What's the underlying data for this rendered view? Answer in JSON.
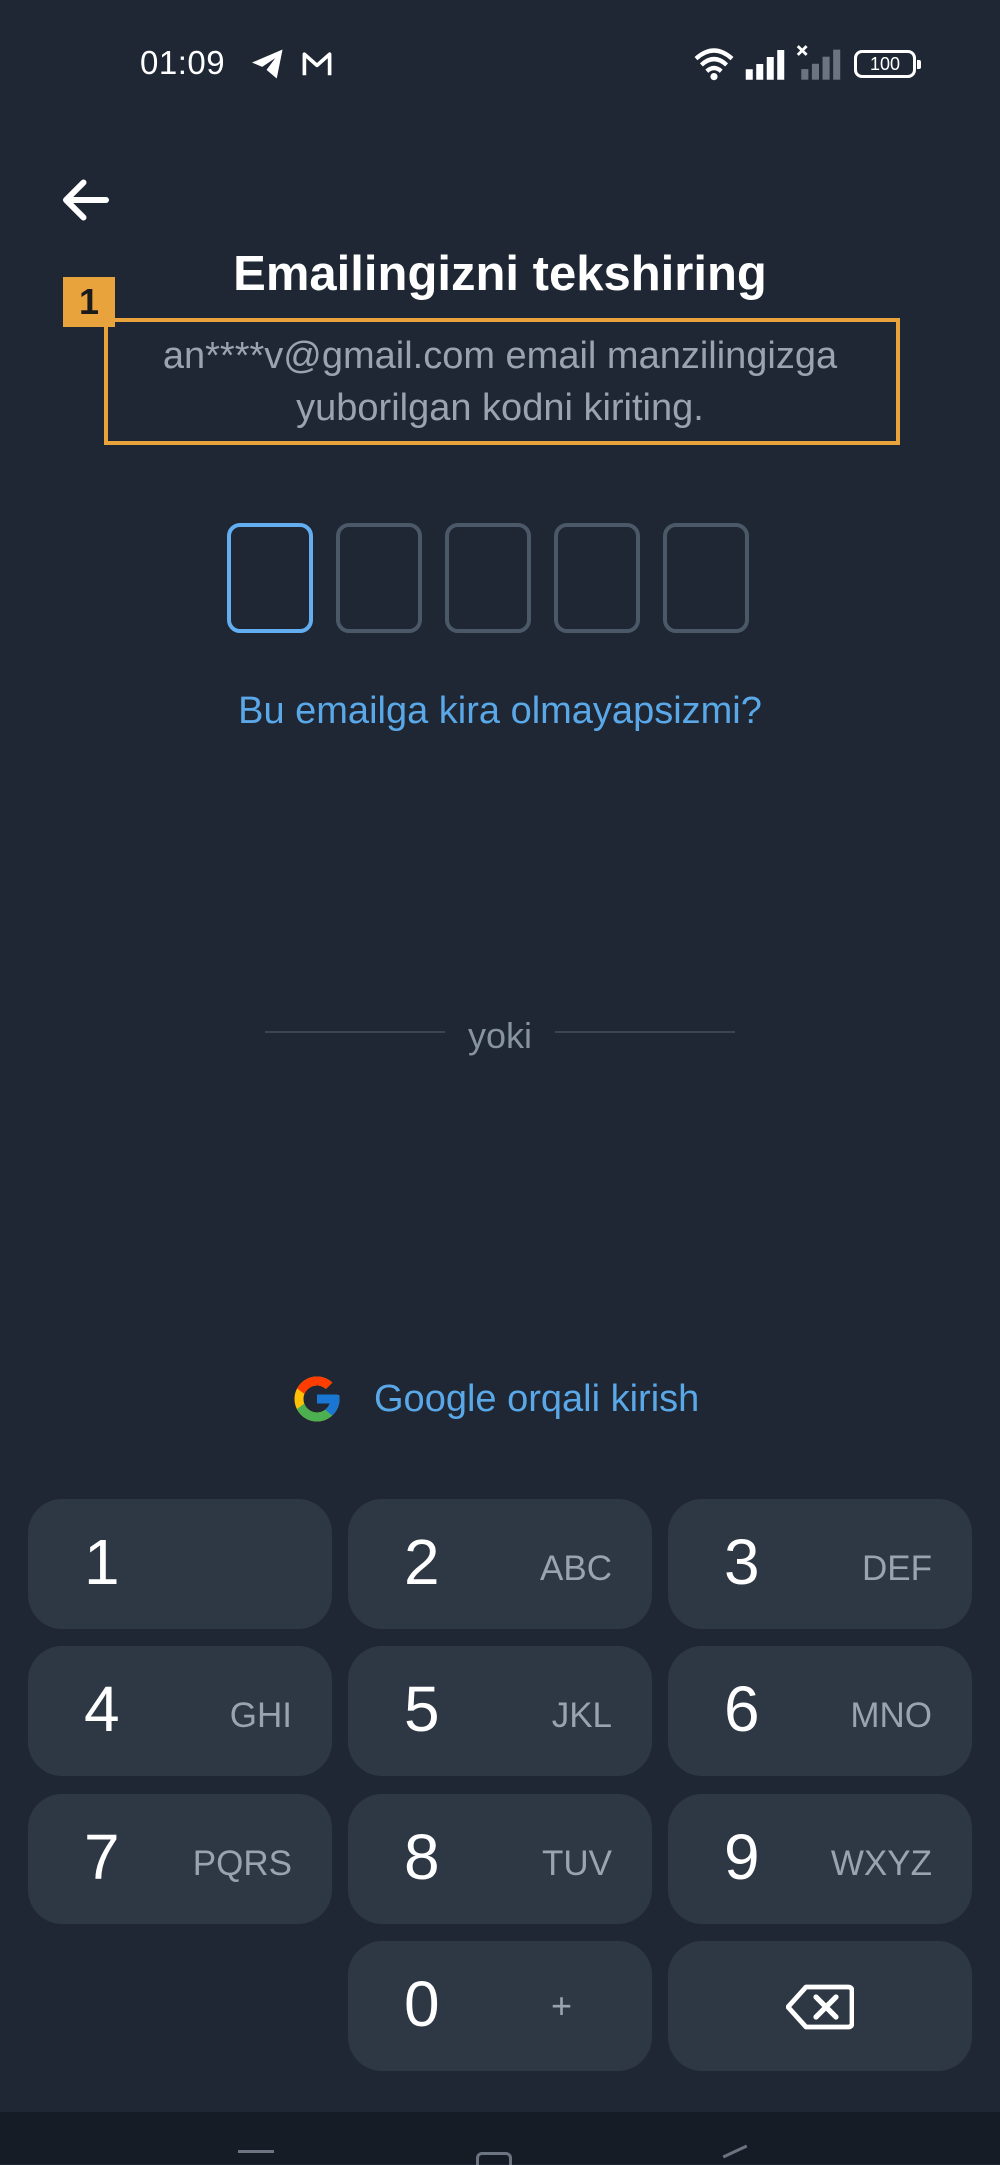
{
  "status_bar": {
    "time": "01:09",
    "battery": "100",
    "icons": [
      "telegram-icon",
      "mail-icon",
      "wifi-icon",
      "signal-icon",
      "signal-no-sim-icon",
      "battery-icon"
    ]
  },
  "header": {
    "back_icon": "arrow-left-icon",
    "title": "Emailingizni tekshiring",
    "annotation_badge": "1"
  },
  "subtitle": {
    "line1": "an****v@gmail.com  email manzilingizga",
    "line2": "yuborilgan kodni kiriting."
  },
  "code_input": {
    "length": 5,
    "active_index": 0,
    "values": [
      "",
      "",
      "",
      "",
      ""
    ]
  },
  "help_link": "Bu emailga kira olmayapsizmi?",
  "divider_text": "yoki",
  "google": {
    "icon": "google-icon",
    "label": "Google orqali kirish"
  },
  "keypad": {
    "keys": [
      {
        "num": "1",
        "letters": ""
      },
      {
        "num": "2",
        "letters": "ABC"
      },
      {
        "num": "3",
        "letters": "DEF"
      },
      {
        "num": "4",
        "letters": "GHI"
      },
      {
        "num": "5",
        "letters": "JKL"
      },
      {
        "num": "6",
        "letters": "MNO"
      },
      {
        "num": "7",
        "letters": "PQRS"
      },
      {
        "num": "8",
        "letters": "TUV"
      },
      {
        "num": "9",
        "letters": "WXYZ"
      },
      {
        "num": "0",
        "letters": "+"
      }
    ],
    "backspace_icon": "backspace-icon"
  },
  "colors": {
    "background": "#1e2733",
    "accent_link": "#5aa8e8",
    "active_box": "#62aef0",
    "highlight": "#e8a33d",
    "key_bg": "#2e3845"
  }
}
